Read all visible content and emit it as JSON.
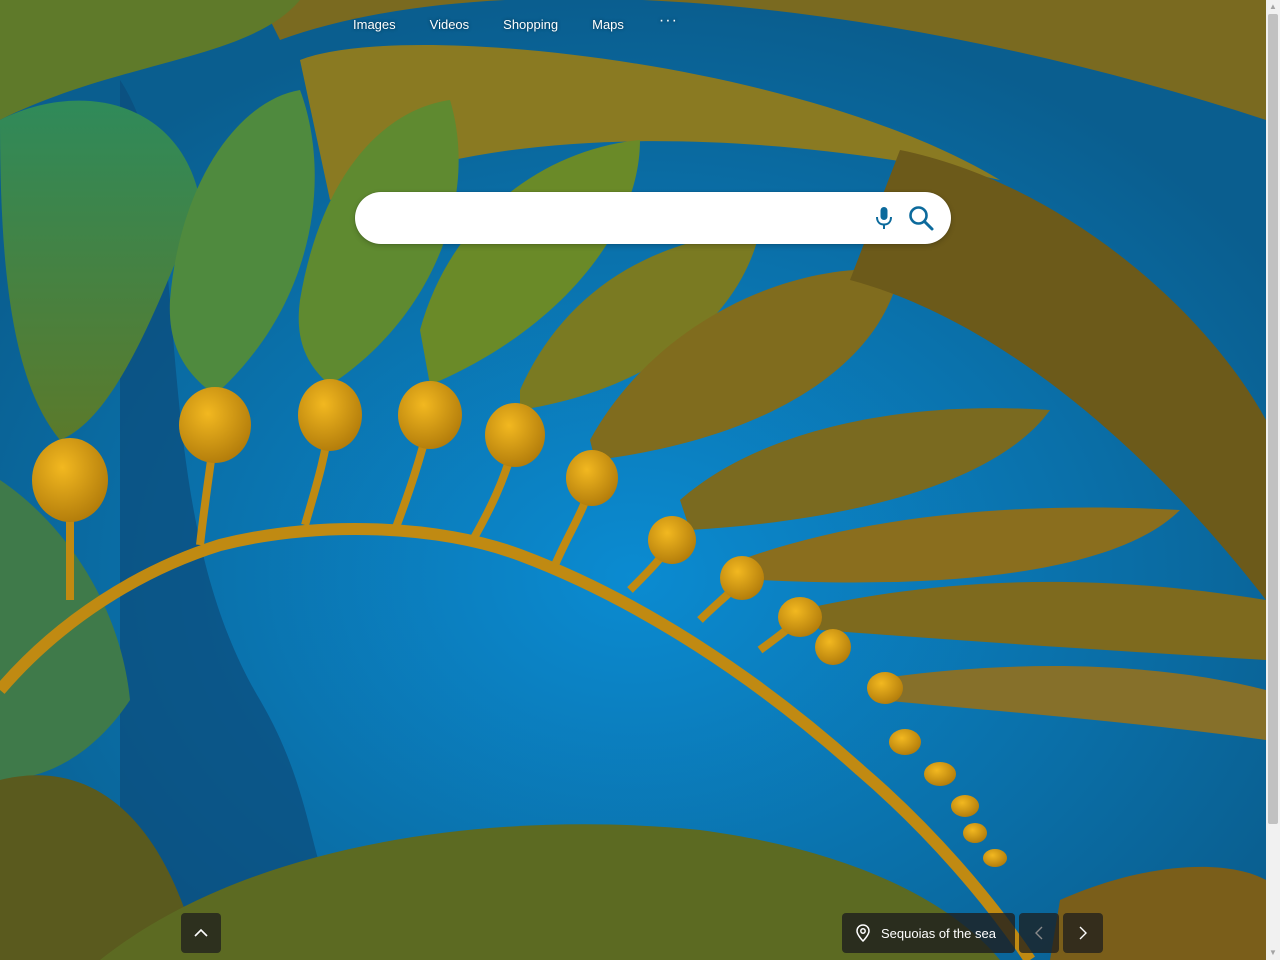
{
  "nav": {
    "items": [
      {
        "label": "Images"
      },
      {
        "label": "Videos"
      },
      {
        "label": "Shopping"
      },
      {
        "label": "Maps"
      }
    ],
    "more_label": "···"
  },
  "search": {
    "value": "",
    "placeholder": ""
  },
  "icons": {
    "mic": "microphone-icon",
    "search": "search-icon",
    "scroll_top": "chevron-up-icon",
    "location": "location-pin-icon",
    "prev": "chevron-left-icon",
    "next": "chevron-right-icon"
  },
  "background": {
    "caption": "Sequoias of the sea"
  },
  "colors": {
    "accent": "#0c6a9c",
    "panel": "#1e1e1e"
  }
}
